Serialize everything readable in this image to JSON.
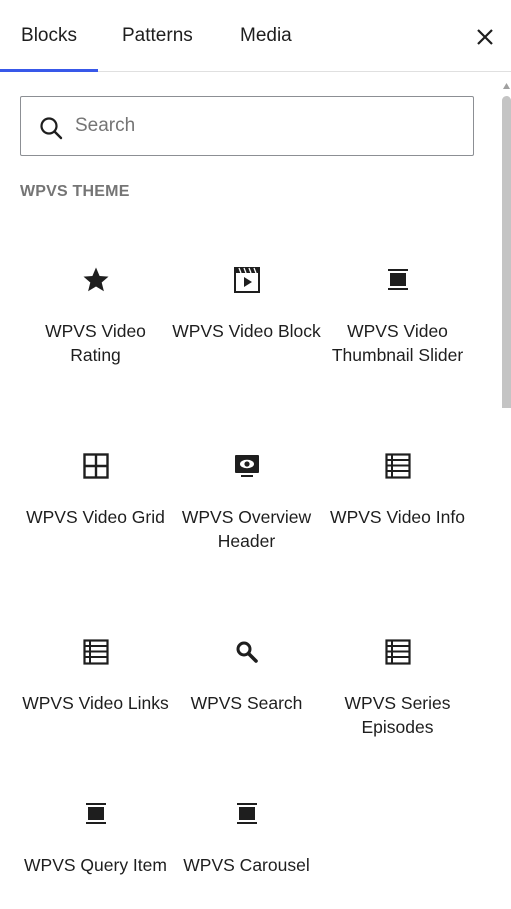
{
  "tabs": [
    {
      "label": "Blocks",
      "active": true
    },
    {
      "label": "Patterns",
      "active": false
    },
    {
      "label": "Media",
      "active": false
    }
  ],
  "close_icon": "close-icon",
  "accent_color": "#3858e9",
  "search": {
    "placeholder": "Search",
    "value": ""
  },
  "section": {
    "title": "WPVS THEME"
  },
  "blocks": [
    {
      "label": "WPVS Video Rating",
      "icon": "star-icon"
    },
    {
      "label": "WPVS Video Block",
      "icon": "video-icon"
    },
    {
      "label": "WPVS Video Thumbnail Slider",
      "icon": "gallery-icon"
    },
    {
      "label": "WPVS Video Grid",
      "icon": "grid-icon"
    },
    {
      "label": "WPVS Overview Header",
      "icon": "cover-icon"
    },
    {
      "label": "WPVS Video Info",
      "icon": "list-icon"
    },
    {
      "label": "WPVS Video Links",
      "icon": "list-icon"
    },
    {
      "label": "WPVS Search",
      "icon": "search-icon"
    },
    {
      "label": "WPVS Series Episodes",
      "icon": "list-icon"
    },
    {
      "label": "WPVS Query Item",
      "icon": "gallery-icon"
    },
    {
      "label": "WPVS Carousel",
      "icon": "gallery-icon"
    }
  ]
}
